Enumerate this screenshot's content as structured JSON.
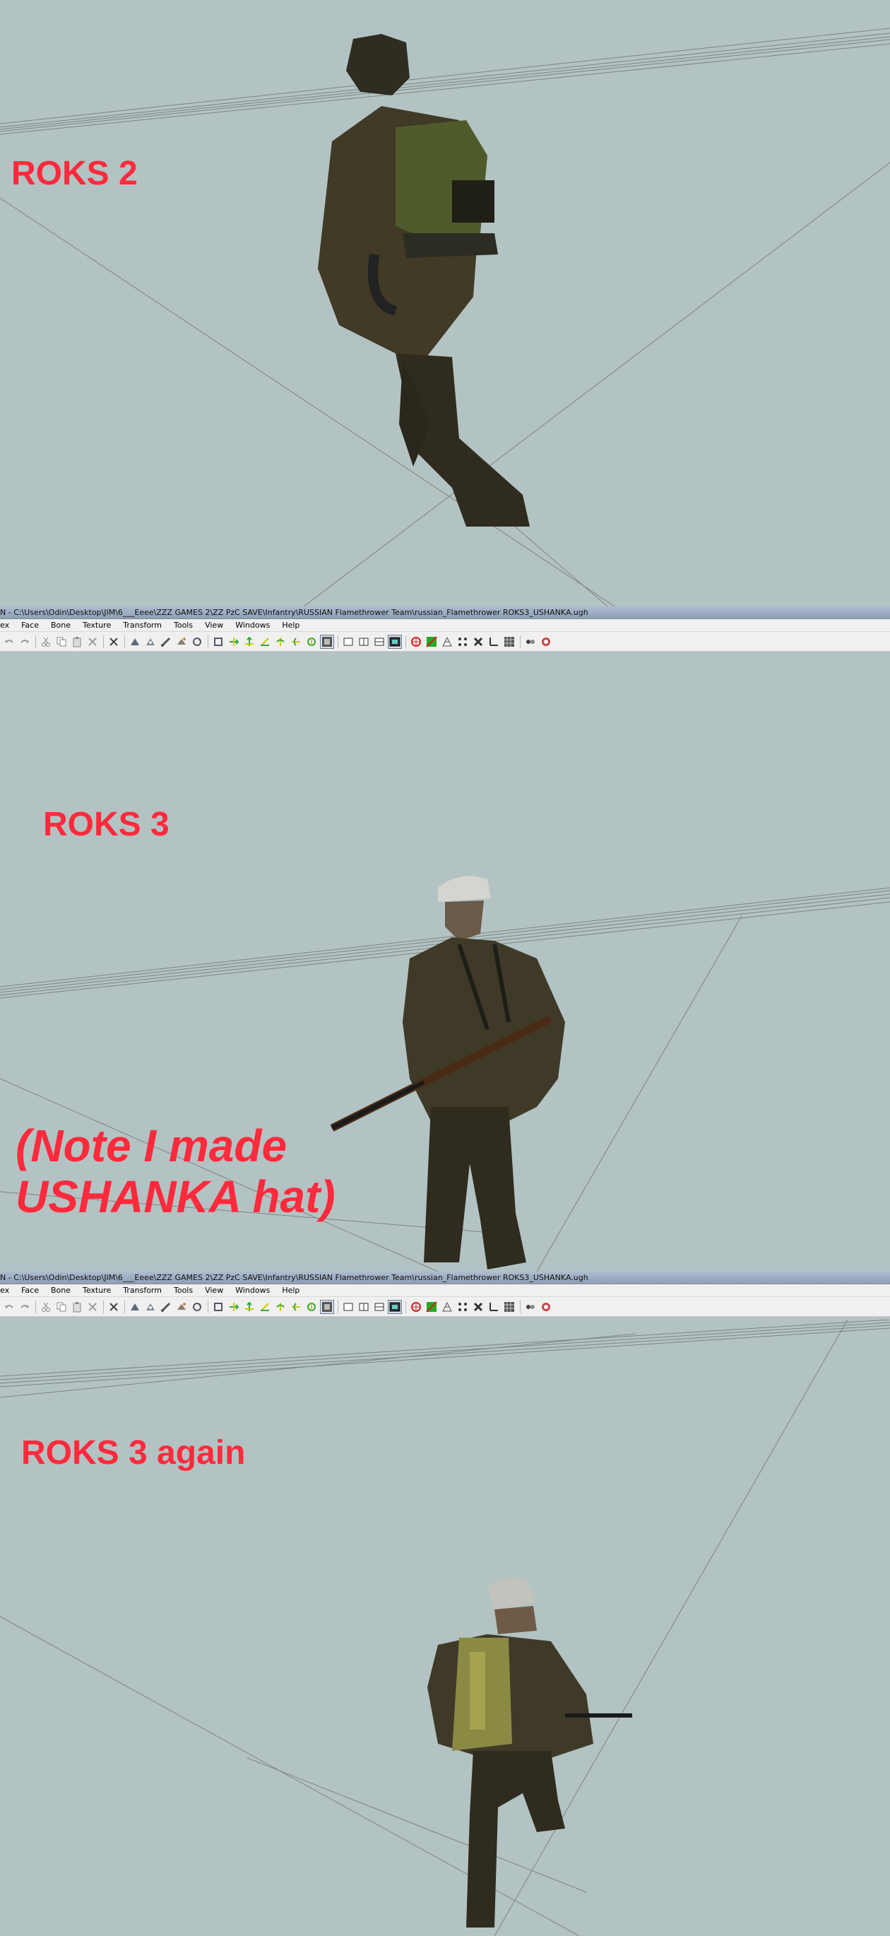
{
  "viewports": [
    {
      "label": "ROKS 2"
    },
    {
      "label": "ROKS 3",
      "note": "(Note I made USHANKA hat)"
    },
    {
      "label": "ROKS 3 again"
    }
  ],
  "window": {
    "title": "N - C:\\Users\\Odin\\Desktop\\JIM\\6___Eeee\\ZZZ GAMES 2\\ZZ PzC SAVE\\Infantry\\RUSSIAN Flamethrower Team\\russian_Flamethrower ROKS3_USHANKA.ugh"
  },
  "menu": [
    "ex",
    "Face",
    "Bone",
    "Texture",
    "Transform",
    "Tools",
    "View",
    "Windows",
    "Help"
  ],
  "toolbar_icons": [
    "undo-icon",
    "redo-icon",
    "cut-icon",
    "copy-icon",
    "paste-icon",
    "delete-icon",
    "close-icon",
    "vertex-select-icon",
    "face-select-icon",
    "bone-select-icon",
    "paint-icon",
    "rotate-icon",
    "scale-icon",
    "move-x-icon",
    "move-y-icon",
    "move-z-icon",
    "rotate-x-icon",
    "rotate-y-icon",
    "rotate-z-icon",
    "grid-snap-icon",
    "view-front-icon",
    "view-side-icon",
    "view-top-icon",
    "view-persp-icon",
    "target-icon",
    "texture-toggle-icon",
    "wire-icon",
    "points-icon",
    "bones-icon",
    "axis-icon",
    "grid-icon",
    "light-icon",
    "render-icon"
  ],
  "colors": {
    "viewport_bg": "#b3c3c3",
    "label_red": "#ff2a3c",
    "uniform": "#3f3a28",
    "tank_olive": "#5c6a33"
  }
}
